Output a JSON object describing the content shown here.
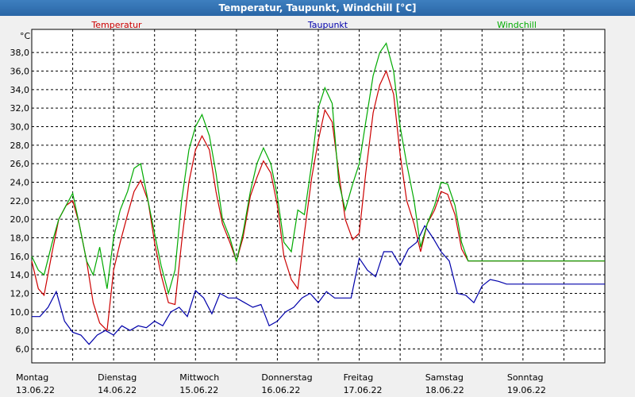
{
  "window": {
    "title": "Temperatur, Taupunkt, Windchill [°C]"
  },
  "chart_data": {
    "type": "line",
    "title": "Temperatur, Taupunkt, Windchill [°C]",
    "ylabel": "°C",
    "ylim": [
      4.5,
      40.5
    ],
    "yticks": [
      6.0,
      8.0,
      10.0,
      12.0,
      14.0,
      16.0,
      18.0,
      20.0,
      22.0,
      24.0,
      26.0,
      28.0,
      30.0,
      32.0,
      34.0,
      36.0,
      38.0
    ],
    "ytick_labels": [
      "6,0",
      "8,0",
      "10,0",
      "12,0",
      "14,0",
      "16,0",
      "18,0",
      "20,0",
      "22,0",
      "24,0",
      "26,0",
      "28,0",
      "30,0",
      "32,0",
      "34,0",
      "36,0",
      "38,0"
    ],
    "xlim": [
      0,
      7
    ],
    "day_labels": [
      {
        "day": "Montag",
        "date": "13.06.22"
      },
      {
        "day": "Dienstag",
        "date": "14.06.22"
      },
      {
        "day": "Mittwoch",
        "date": "15.06.22"
      },
      {
        "day": "Donnerstag",
        "date": "16.06.22"
      },
      {
        "day": "Freitag",
        "date": "17.06.22"
      },
      {
        "day": "Samstag",
        "date": "18.06.22"
      },
      {
        "day": "Sonntag",
        "date": "19.06.22"
      }
    ],
    "grid": true,
    "legend_placement": "top",
    "series": [
      {
        "name": "Temperatur",
        "color": "#cc0000",
        "x": [
          0,
          0.08,
          0.15,
          0.25,
          0.33,
          0.42,
          0.5,
          0.58,
          0.67,
          0.75,
          0.83,
          0.92,
          1.0,
          1.08,
          1.17,
          1.25,
          1.33,
          1.42,
          1.5,
          1.58,
          1.67,
          1.75,
          1.83,
          1.92,
          2.0,
          2.08,
          2.17,
          2.25,
          2.33,
          2.42,
          2.5,
          2.58,
          2.67,
          2.75,
          2.83,
          2.92,
          3.0,
          3.08,
          3.17,
          3.25,
          3.33,
          3.42,
          3.5,
          3.58,
          3.67,
          3.75,
          3.83,
          3.92,
          4.0,
          4.08,
          4.17,
          4.25,
          4.33,
          4.42,
          4.5,
          4.58,
          4.67,
          4.75,
          4.83,
          4.92,
          5.0,
          5.08,
          5.17,
          5.25,
          5.33,
          5.42,
          5.5,
          5.58,
          5.67,
          5.75,
          5.83,
          5.92,
          6.0,
          6.08,
          6.17,
          6.25,
          6.33,
          6.42,
          6.5,
          6.58,
          6.67,
          6.75,
          6.83,
          6.92,
          7.0
        ],
        "y": [
          15.5,
          12.5,
          11.8,
          16.5,
          20.0,
          21.5,
          22.0,
          19.5,
          15.5,
          11.0,
          8.8,
          8.0,
          14.5,
          17.5,
          20.5,
          23.0,
          24.2,
          22.0,
          17.5,
          14.0,
          11.0,
          10.8,
          17.5,
          24.0,
          27.5,
          29.0,
          27.5,
          23.0,
          19.5,
          17.5,
          15.5,
          18.0,
          22.5,
          24.5,
          26.3,
          25.0,
          21.5,
          16.0,
          13.5,
          12.5,
          18.5,
          24.5,
          28.5,
          31.8,
          30.5,
          25.0,
          20.0,
          17.8,
          18.5,
          25.0,
          31.5,
          34.5,
          36.0,
          33.5,
          27.0,
          22.0,
          19.5,
          16.5,
          19.5,
          21.0,
          23.0,
          22.7,
          20.5,
          16.8,
          15.5,
          15.5,
          15.5,
          15.5,
          15.5,
          15.5,
          15.5,
          15.5,
          15.5,
          15.5,
          15.5,
          15.5,
          15.5,
          15.5,
          15.5,
          15.5,
          15.5,
          15.5,
          15.5,
          15.5,
          15.5
        ]
      },
      {
        "name": "Taupunkt",
        "color": "#0000aa",
        "x": [
          0,
          0.1,
          0.2,
          0.3,
          0.4,
          0.5,
          0.6,
          0.7,
          0.8,
          0.9,
          1.0,
          1.1,
          1.2,
          1.3,
          1.4,
          1.5,
          1.6,
          1.7,
          1.8,
          1.9,
          2.0,
          2.1,
          2.2,
          2.3,
          2.4,
          2.5,
          2.6,
          2.7,
          2.8,
          2.9,
          3.0,
          3.1,
          3.2,
          3.3,
          3.4,
          3.5,
          3.6,
          3.7,
          3.8,
          3.9,
          4.0,
          4.1,
          4.2,
          4.3,
          4.4,
          4.5,
          4.6,
          4.7,
          4.8,
          4.9,
          5.0,
          5.1,
          5.2,
          5.3,
          5.4,
          5.5,
          5.6,
          5.7,
          5.8,
          5.9,
          6.0,
          6.1,
          6.2,
          6.3,
          6.4,
          6.5,
          6.6,
          6.7,
          6.8,
          6.9,
          7.0
        ],
        "y": [
          9.5,
          9.5,
          10.5,
          12.2,
          9.0,
          7.8,
          7.5,
          6.5,
          7.5,
          8.0,
          7.5,
          8.5,
          8.0,
          8.5,
          8.3,
          9.0,
          8.5,
          10.0,
          10.5,
          9.5,
          12.3,
          11.5,
          9.8,
          12.0,
          11.5,
          11.5,
          11.0,
          10.5,
          10.8,
          8.5,
          9.0,
          10.0,
          10.5,
          11.5,
          12.0,
          11.0,
          12.2,
          11.5,
          11.5,
          11.5,
          15.8,
          14.5,
          13.8,
          16.5,
          16.5,
          15.0,
          16.8,
          17.5,
          19.3,
          18.0,
          16.5,
          15.5,
          12.0,
          11.8,
          11.0,
          12.8,
          13.5,
          13.3,
          13.0,
          13.0,
          13.0,
          13.0,
          13.0,
          13.0,
          13.0,
          13.0,
          13.0,
          13.0,
          13.0,
          13.0,
          13.0
        ]
      },
      {
        "name": "Windchill",
        "color": "#00aa00",
        "x": [
          0,
          0.08,
          0.15,
          0.25,
          0.33,
          0.42,
          0.5,
          0.58,
          0.67,
          0.75,
          0.83,
          0.92,
          1.0,
          1.08,
          1.17,
          1.25,
          1.33,
          1.42,
          1.5,
          1.58,
          1.67,
          1.75,
          1.83,
          1.92,
          2.0,
          2.08,
          2.17,
          2.25,
          2.33,
          2.42,
          2.5,
          2.58,
          2.67,
          2.75,
          2.83,
          2.92,
          3.0,
          3.08,
          3.17,
          3.25,
          3.33,
          3.42,
          3.5,
          3.58,
          3.67,
          3.75,
          3.83,
          3.92,
          4.0,
          4.08,
          4.17,
          4.25,
          4.33,
          4.42,
          4.5,
          4.58,
          4.67,
          4.75,
          4.83,
          4.92,
          5.0,
          5.08,
          5.17,
          5.25,
          5.33,
          5.42,
          5.5,
          5.58,
          5.67,
          5.75,
          5.83,
          5.92,
          6.0,
          6.08,
          6.17,
          6.25,
          6.33,
          6.42,
          6.5,
          6.58,
          6.67,
          6.75,
          6.83,
          6.92,
          7.0
        ],
        "y": [
          16.0,
          14.5,
          14.0,
          17.5,
          20.0,
          21.5,
          22.8,
          19.5,
          15.5,
          14.0,
          17.0,
          12.5,
          18.0,
          21.0,
          23.0,
          25.5,
          26.0,
          22.0,
          18.5,
          15.0,
          12.0,
          14.5,
          22.0,
          27.5,
          30.0,
          31.3,
          29.0,
          25.0,
          20.0,
          18.0,
          15.5,
          18.5,
          23.0,
          26.0,
          27.7,
          26.0,
          22.5,
          17.5,
          16.5,
          21.0,
          20.5,
          26.0,
          32.0,
          34.2,
          32.5,
          24.0,
          21.0,
          23.8,
          26.0,
          30.5,
          35.5,
          38.0,
          39.0,
          36.0,
          30.0,
          26.0,
          22.0,
          17.0,
          19.5,
          21.5,
          24.0,
          23.8,
          21.5,
          17.5,
          15.5,
          15.5,
          15.5,
          15.5,
          15.5,
          15.5,
          15.5,
          15.5,
          15.5,
          15.5,
          15.5,
          15.5,
          15.5,
          15.5,
          15.5,
          15.5,
          15.5,
          15.5,
          15.5,
          15.5,
          15.5
        ]
      }
    ]
  }
}
